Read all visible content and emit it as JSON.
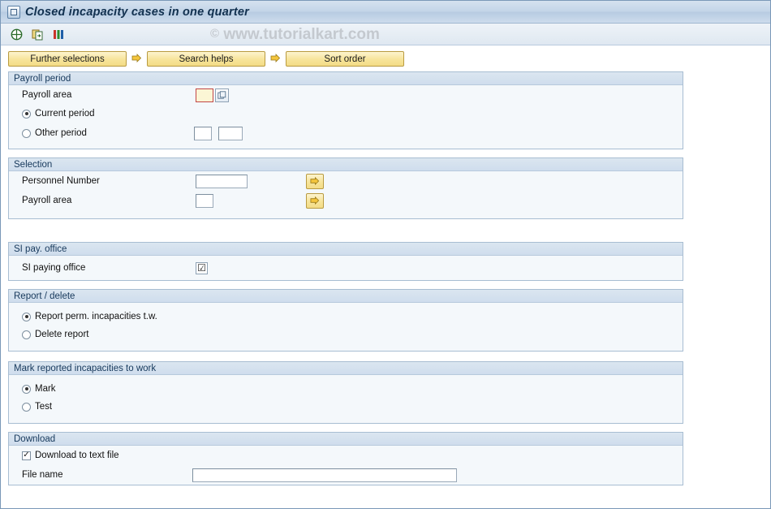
{
  "window": {
    "title": "Closed incapacity cases in one quarter",
    "icon": "window-menu-icon"
  },
  "toolbar": {
    "buttons": [
      {
        "name": "execute-icon",
        "glyph": "execute"
      },
      {
        "name": "execute-multiple-selection-icon",
        "glyph": "multi"
      },
      {
        "name": "variant-icon",
        "glyph": "variant"
      }
    ],
    "watermark": "www.tutorialkart.com",
    "watermark_mark": "©"
  },
  "actions": {
    "further_selections": "Further selections",
    "search_helps": "Search helps",
    "sort_order": "Sort order"
  },
  "groups": {
    "payroll_period": {
      "title": "Payroll period",
      "payroll_area_label": "Payroll area",
      "payroll_area_value": "",
      "current_period_label": "Current period",
      "other_period_label": "Other period",
      "other_period_value_1": "",
      "other_period_value_2": ""
    },
    "selection": {
      "title": "Selection",
      "personnel_number_label": "Personnel Number",
      "personnel_number_value": "",
      "payroll_area_label": "Payroll area",
      "payroll_area_value": ""
    },
    "si_pay_office": {
      "title": "SI pay. office",
      "si_paying_office_label": "SI paying office",
      "si_paying_office_checked": "☑"
    },
    "report_delete": {
      "title": "Report / delete",
      "report_option": "Report perm. incapacities t.w.",
      "delete_option": "Delete report"
    },
    "mark_reported": {
      "title": "Mark reported incapacities to work",
      "mark_option": "Mark",
      "test_option": "Test"
    },
    "download": {
      "title": "Download",
      "download_to_text_file_label": "Download to text file",
      "download_checked": "✓",
      "file_name_label": "File name",
      "file_name_value": ""
    }
  },
  "colors": {
    "title_text": "#11304f",
    "accent_yellow": "#f7e49a",
    "group_border": "#a8bdd2",
    "focus_red": "#c24646"
  }
}
